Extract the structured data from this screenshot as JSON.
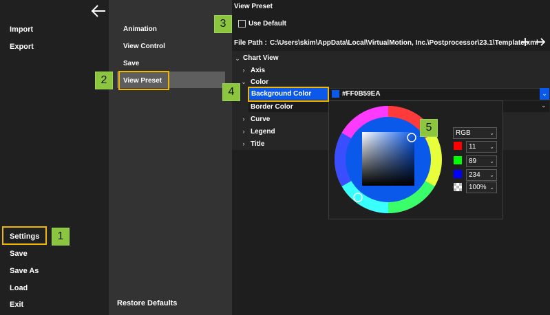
{
  "sidebar": {
    "back_icon": "arrow-left-icon",
    "items_top": [
      "Import",
      "Export"
    ],
    "items_bottom": [
      "Settings",
      "Save",
      "Save As",
      "Load",
      "Exit"
    ]
  },
  "settings_menu": {
    "items": [
      "Animation",
      "View Control",
      "Save",
      "View Preset"
    ],
    "restore_label": "Restore Defaults"
  },
  "view_preset": {
    "title": "View Preset",
    "use_default_label": "Use Default",
    "use_default_checked": false,
    "file_path_label": "File Path :",
    "file_path_value": "C:\\Users\\skim\\AppData\\Local\\VirtualMotion, Inc.\\Postprocessor\\23.1\\Template.xml",
    "add_icon": "plus-icon",
    "go_icon": "arrow-right-icon"
  },
  "tree": {
    "chart_view": "Chart View",
    "axis": "Axis",
    "color": "Color",
    "background_color": "Background Color",
    "background_color_value": "#FF0B59EA",
    "border_color": "Border Color",
    "curve": "Curve",
    "legend": "Legend",
    "title": "Title"
  },
  "color_picker": {
    "mode": "RGB",
    "r": "11",
    "g": "89",
    "b": "234",
    "alpha": "100%",
    "swatch_color": "#0b59ea"
  },
  "callouts": [
    "1",
    "2",
    "3",
    "4",
    "5"
  ],
  "colors": {
    "accent": "#f2b705",
    "selection": "#0b59ea",
    "badge": "#8cc63f"
  }
}
